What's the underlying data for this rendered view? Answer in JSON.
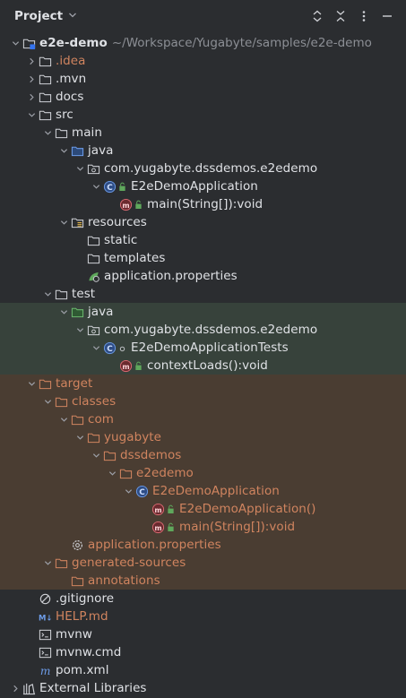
{
  "header": {
    "title": "Project"
  },
  "colors": {
    "test_bg": "#37423b",
    "excluded_bg": "#4a3d32",
    "excluded_text": "#d0845f"
  },
  "root": {
    "name": "e2e-demo",
    "path": "~/Workspace/Yugabyte/samples/e2e-demo"
  },
  "items": {
    "idea": ".idea",
    "mvn": ".mvn",
    "docs": "docs",
    "src": "src",
    "main": "main",
    "java": "java",
    "pkg": "com.yugabyte.dssdemos.e2edemo",
    "app_class": "E2eDemoApplication",
    "main_method": "main(String[]):void",
    "resources": "resources",
    "static": "static",
    "templates": "templates",
    "app_props": "application.properties",
    "test": "test",
    "test_java": "java",
    "test_pkg": "com.yugabyte.dssdemos.e2edemo",
    "test_class": "E2eDemoApplicationTests",
    "context_loads": "contextLoads():void",
    "target": "target",
    "classes": "classes",
    "com": "com",
    "yugabyte": "yugabyte",
    "dssdemos": "dssdemos",
    "e2edemo": "e2edemo",
    "t_app_class": "E2eDemoApplication",
    "t_ctor": "E2eDemoApplication()",
    "t_main": "main(String[]):void",
    "t_props": "application.properties",
    "generated": "generated-sources",
    "annotations": "annotations",
    "gitignore": ".gitignore",
    "help": "HELP.md",
    "mvnw": "mvnw",
    "mvnw_cmd": "mvnw.cmd",
    "pom": "pom.xml",
    "ext_libs": "External Libraries"
  }
}
